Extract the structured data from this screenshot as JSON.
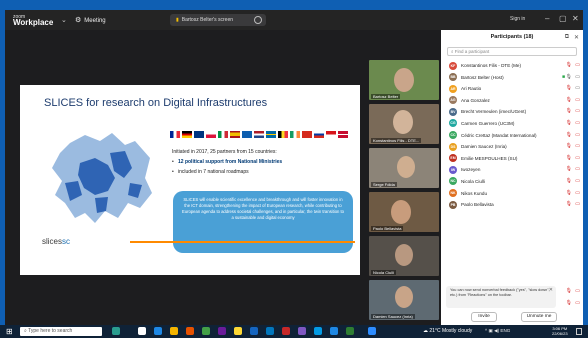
{
  "app": {
    "logo_line1": "zoom",
    "logo_line2": "Workplace",
    "meeting_label": "Meeting",
    "share_text": "Bartosz Belter's screen",
    "signin_label": "Sign in"
  },
  "slide": {
    "title": "SLICES for research on Digital Infrastructures",
    "line1": "Initiated in 2017, 25 partners from 15 countries:",
    "bullet1": "12 political support from National Ministries",
    "bullet2": "included in 7 national roadmaps",
    "bubble_text": "SLICES will enable scientific excellence and breakthrough and will foster innovation in the ICT domain, strengthening the impact of European research, while contributing to European agenda to address societal challenges, and in particular, the twin transition to a sustainable and digital economy",
    "logo_text": "slices",
    "logo_suffix": "sc"
  },
  "tiles": [
    {
      "name": "Bartosz Belter",
      "bg": "#6b8a4e"
    },
    {
      "name": "Konstantinos Filis - DTE...",
      "bg": "#7a6a58"
    },
    {
      "name": "Serge Fdida",
      "bg": "#8c8478"
    },
    {
      "name": "Paolo Bellavista",
      "bg": "#6e5a44"
    },
    {
      "name": "Nicola Ciulli",
      "bg": "#55504a"
    },
    {
      "name": "Damien Saucez (Inria)",
      "bg": "#5e6a72"
    }
  ],
  "panel": {
    "title": "Participants (18)",
    "search_placeholder": "Find a participant",
    "participants": [
      {
        "initials": "KF",
        "name": "Konstantinos Filis - DTE (Me)",
        "color": "#d84a3a"
      },
      {
        "initials": "BB",
        "name": "Bartosz Belter (Host)",
        "color": "#8a6d52"
      },
      {
        "initials": "AR",
        "name": "Ari Rautio",
        "color": "#f0a020"
      },
      {
        "initials": "AG",
        "name": "Ana Gonzalez",
        "color": "#9a7a60"
      },
      {
        "initials": "BV",
        "name": "Brecht Vermeulen (imec/UGent)",
        "color": "#4a6a8a"
      },
      {
        "initials": "CG",
        "name": "Carmen Guerrero (UC3M)",
        "color": "#20a8a0"
      },
      {
        "initials": "CC",
        "name": "Cédric Crettaz (Mandat International)",
        "color": "#3aa860"
      },
      {
        "initials": "DS",
        "name": "Damien Saucez (Inria)",
        "color": "#e8a020"
      },
      {
        "initials": "EM",
        "name": "Emilie MESPOULHES (SU)",
        "color": "#c03020"
      },
      {
        "initials": "IW",
        "name": "Iwozeyen",
        "color": "#6a5acd"
      },
      {
        "initials": "NC",
        "name": "Nicola Ciulli",
        "color": "#3aa860"
      },
      {
        "initials": "NK",
        "name": "Nikos Kundu",
        "color": "#e07020"
      },
      {
        "initials": "PB",
        "name": "Paolo Bellavista",
        "color": "#7a5a40"
      }
    ],
    "notice": "You can now send nonverbal feedback (\"yes\", \"slow down\", etc.) from \"Reactions\" on the toolbar.",
    "invite_label": "Invite",
    "unmute_label": "Unmute me"
  },
  "taskbar": {
    "search_placeholder": "Type here to search",
    "weather": "21°C  Mostly cloudy",
    "tray_text": "ENG",
    "time": "3:06 PM",
    "date": "22/06/23"
  }
}
